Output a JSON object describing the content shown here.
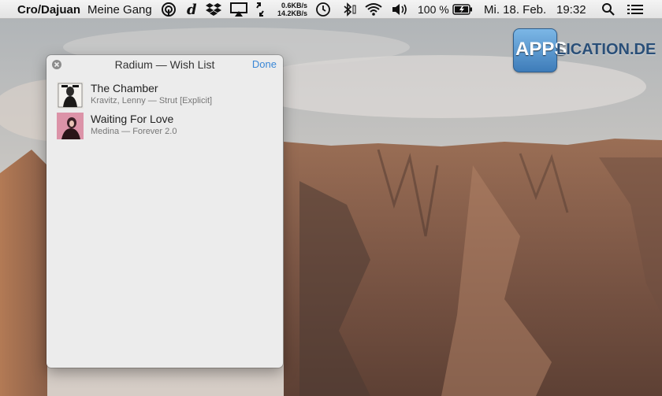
{
  "menubar": {
    "app_name": "Cro/Dajuan",
    "track": "Meine Gang",
    "net_up": "0.6KB/s",
    "net_down": "14.2KB/s",
    "battery_percent": "100 %",
    "date": "Mi. 18. Feb.",
    "time": "19:32",
    "icons": [
      "airdrop-icon",
      "d-app-icon",
      "dropbox-icon",
      "airplay-icon",
      "sync-icon",
      "time-machine-icon",
      "bluetooth-icon",
      "wifi-icon",
      "volume-icon",
      "battery-icon",
      "search-icon",
      "list-icon"
    ]
  },
  "watermark": {
    "strong": "APPS",
    "rest": "LICATION.DE"
  },
  "panel": {
    "title": "Radium — Wish List",
    "done_label": "Done",
    "items": [
      {
        "song": "The Chamber",
        "meta": "Kravitz, Lenny — Strut [Explicit]"
      },
      {
        "song": "Waiting For Love",
        "meta": "Medina — Forever 2.0"
      }
    ]
  },
  "colors": {
    "accent": "#3a87d6",
    "panel_bg": "#ececec",
    "menubar_bg": "#e9e9e9"
  }
}
